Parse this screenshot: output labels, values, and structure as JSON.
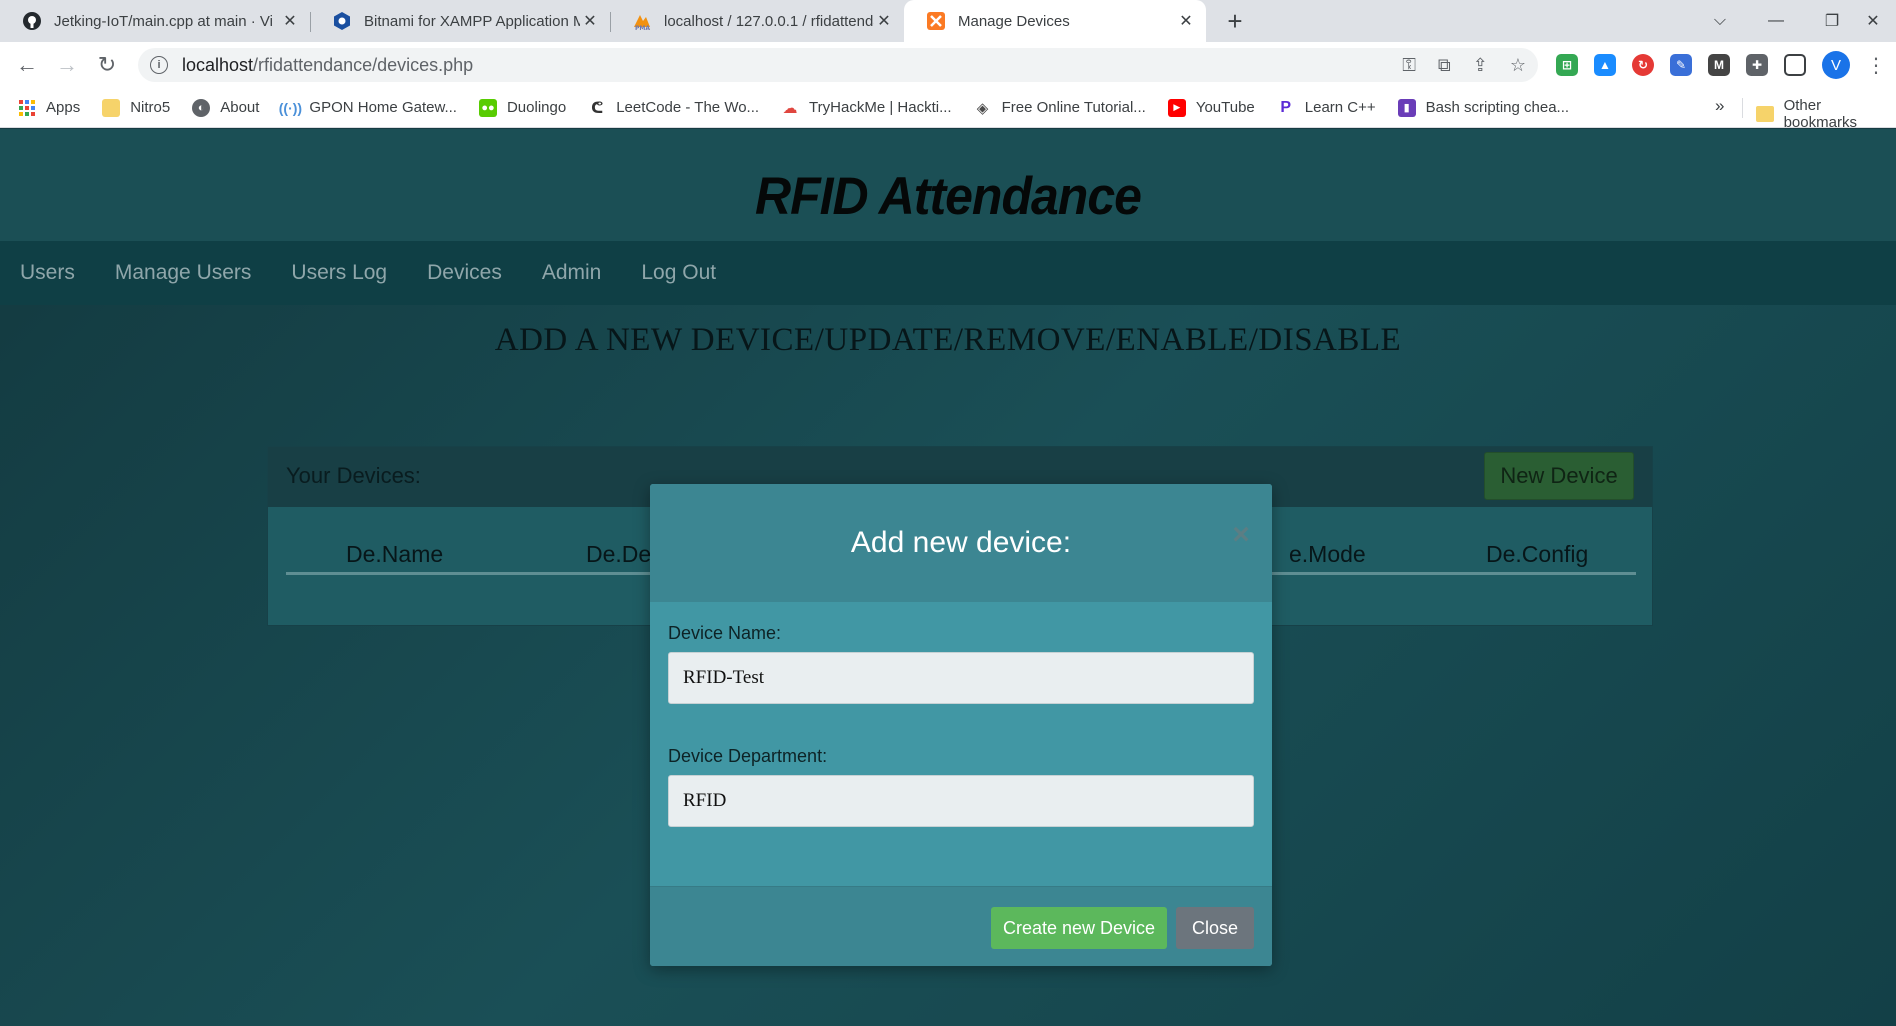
{
  "browser": {
    "tabs": [
      {
        "title": "Jetking-IoT/main.cpp at main · Vi",
        "icon": "github-icon"
      },
      {
        "title": "Bitnami for XAMPP Application M",
        "icon": "bitnami-icon"
      },
      {
        "title": "localhost / 127.0.0.1 / rfidattenda",
        "icon": "phpmyadmin-icon"
      },
      {
        "title": "Manage Devices",
        "icon": "xampp-icon"
      }
    ],
    "active_tab": 3,
    "url_host": "localhost",
    "url_path": "/rfidattendance/devices.php",
    "profile_initial": "V",
    "bookmarks": [
      {
        "label": "Apps",
        "icon": "apps-grid-icon",
        "color": "#ea4335"
      },
      {
        "label": "Nitro5",
        "icon": "folder-icon",
        "color": "#f6c445"
      },
      {
        "label": "About",
        "icon": "globe-icon",
        "color": "#5f6368"
      },
      {
        "label": "GPON Home Gatew...",
        "icon": "wifi-signal-icon",
        "color": "#4a90d9"
      },
      {
        "label": "Duolingo",
        "icon": "duolingo-icon",
        "color": "#58cc02"
      },
      {
        "label": "LeetCode - The Wo...",
        "icon": "leetcode-icon",
        "color": "#333333"
      },
      {
        "label": "TryHackMe | Hackti...",
        "icon": "cloud-icon",
        "color": "#e0463f"
      },
      {
        "label": "Free Online Tutorial...",
        "icon": "diamond-icon",
        "color": "#4a4a4a"
      },
      {
        "label": "YouTube",
        "icon": "youtube-icon",
        "color": "#ff0000"
      },
      {
        "label": "Learn C++",
        "icon": "learncpp-icon",
        "color": "#5b2bd6"
      },
      {
        "label": "Bash scripting chea...",
        "icon": "bash-icon",
        "color": "#6a3db8"
      }
    ],
    "other_bookmarks": "Other bookmarks"
  },
  "site": {
    "title": "RFID Attendance",
    "nav": [
      "Users",
      "Manage Users",
      "Users Log",
      "Devices",
      "Admin",
      "Log Out"
    ],
    "heading": "ADD A NEW DEVICE/UPDATE/REMOVE/ENABLE/DISABLE"
  },
  "devices_panel": {
    "title": "Your Devices:",
    "new_button": "New Device",
    "columns": [
      "De.Name",
      "De.De",
      "e.Mode",
      "De.Config"
    ]
  },
  "modal": {
    "title": "Add new device:",
    "close_symbol": "×",
    "device_name_label": "Device Name:",
    "device_name_value": "RFID-Test",
    "device_dept_label": "Device Department:",
    "device_dept_value": "RFID",
    "create_button": "Create new Device",
    "close_button": "Close"
  }
}
